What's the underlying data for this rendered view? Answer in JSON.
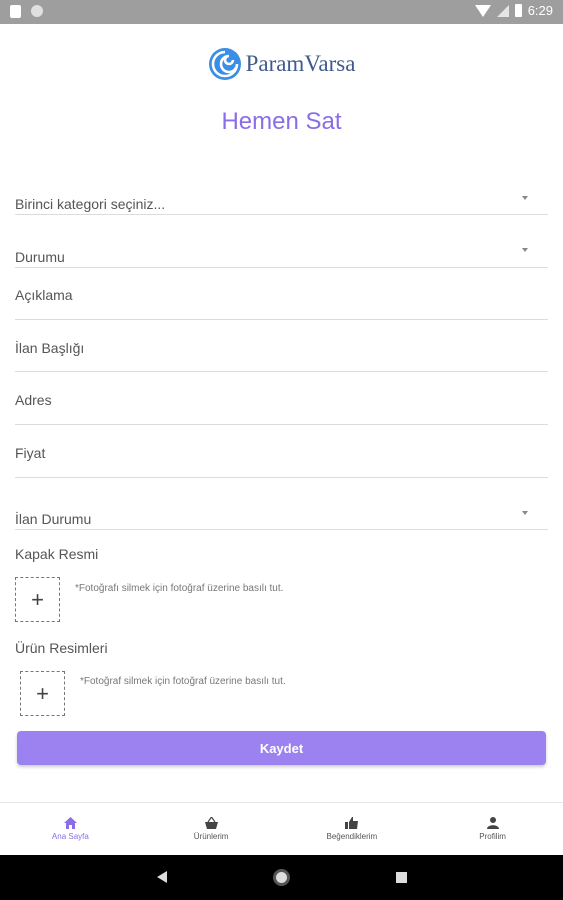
{
  "status_bar": {
    "time": "6:29"
  },
  "logo": {
    "text": "ParamVarsa"
  },
  "page_title": "Hemen Sat",
  "form": {
    "category_select": "Birinci kategori seçiniz...",
    "condition_select": "Durumu",
    "description": "Açıklama",
    "listing_title": "İlan Başlığı",
    "address": "Adres",
    "price": "Fiyat",
    "listing_status_select": "İlan Durumu"
  },
  "cover_image": {
    "label": "Kapak Resmi",
    "add_symbol": "+",
    "hint": "*Fotoğrafı silmek için fotoğraf üzerine basılı tut."
  },
  "product_images": {
    "label": "Ürün Resimleri",
    "add_symbol": "+",
    "hint": "*Fotoğraf silmek için fotoğraf üzerine basılı tut."
  },
  "save_button": "Kaydet",
  "bottom_nav": {
    "items": [
      {
        "label": "Ana Sayfa",
        "icon": "home-icon",
        "active": true
      },
      {
        "label": "Ürünlerim",
        "icon": "basket-icon",
        "active": false
      },
      {
        "label": "Beğendiklerim",
        "icon": "thumbs-up-icon",
        "active": false
      },
      {
        "label": "Profilim",
        "icon": "person-icon",
        "active": false
      }
    ]
  },
  "colors": {
    "accent": "#8a6ee8",
    "button": "#9c82f0",
    "logo": "#3f5a8c",
    "status_bar": "#9e9e9e"
  }
}
